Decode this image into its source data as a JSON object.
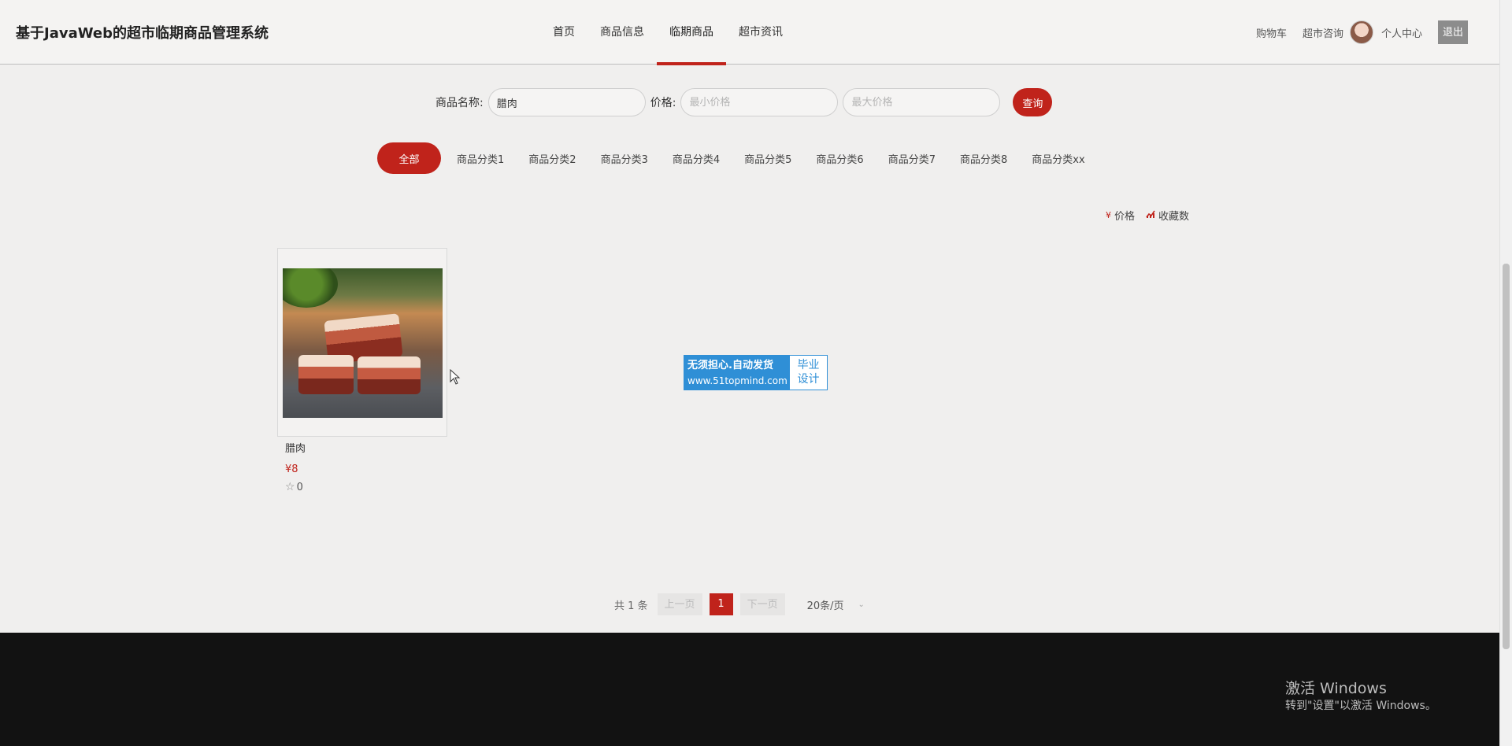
{
  "header": {
    "title": "基于JavaWeb的超市临期商品管理系统",
    "nav": [
      {
        "label": "首页"
      },
      {
        "label": "商品信息"
      },
      {
        "label": "临期商品"
      },
      {
        "label": "超市资讯"
      }
    ],
    "right": {
      "cart": "购物车",
      "consult": "超市咨询",
      "profile": "个人中心",
      "logout": "退出"
    }
  },
  "search": {
    "name_label": "商品名称:",
    "name_value": "腊肉",
    "price_label": "价格:",
    "min_placeholder": "最小价格",
    "max_placeholder": "最大价格",
    "query_label": "查询"
  },
  "categories": {
    "all": "全部",
    "items": [
      "商品分类1",
      "商品分类2",
      "商品分类3",
      "商品分类4",
      "商品分类5",
      "商品分类6",
      "商品分类7",
      "商品分类8",
      "商品分类xx"
    ]
  },
  "sort": {
    "price_icon": "¥",
    "price": "价格",
    "fav_icon": "chart-icon",
    "fav": "收藏数"
  },
  "product": {
    "name": "腊肉",
    "price": "¥8",
    "favorites": "0"
  },
  "badge": {
    "line1": "无须担心.自动发货",
    "line2": "www.51topmind.com",
    "right_line1": "毕业",
    "right_line2": "设计"
  },
  "pagination": {
    "total": "共 1 条",
    "prev": "上一页",
    "current": "1",
    "next": "下一页",
    "page_size": "20条/页"
  },
  "footer": {
    "windows_title": "激活 Windows",
    "windows_sub": "转到\"设置\"以激活 Windows。"
  },
  "colors": {
    "accent": "#c0231b",
    "badge_blue": "#2f8fd6",
    "footer_bg": "#121212"
  }
}
